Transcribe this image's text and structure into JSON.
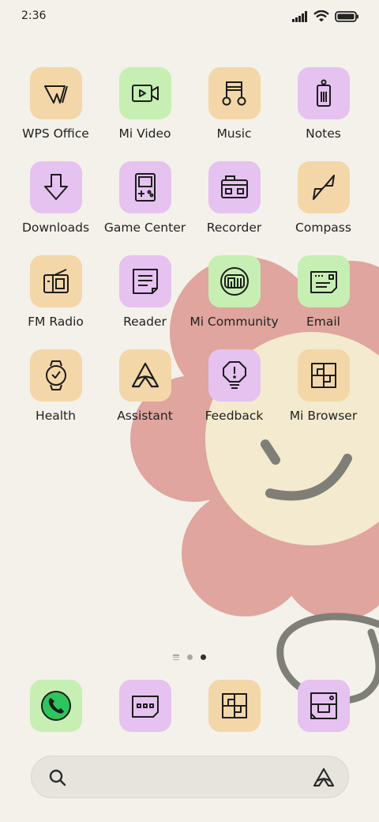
{
  "status_bar": {
    "time": "2:36",
    "icons": [
      "signal-icon",
      "wifi-icon",
      "battery-icon"
    ]
  },
  "apps": [
    {
      "label": "WPS Office",
      "color": "orange",
      "icon": "wps-office-icon"
    },
    {
      "label": "Mi Video",
      "color": "green",
      "icon": "video-camera-icon"
    },
    {
      "label": "Music",
      "color": "orange",
      "icon": "music-note-icon"
    },
    {
      "label": "Notes",
      "color": "purple",
      "icon": "notes-tag-icon"
    },
    {
      "label": "Downloads",
      "color": "purple",
      "icon": "download-arrow-icon"
    },
    {
      "label": "Game Center",
      "color": "purple",
      "icon": "gameboy-icon"
    },
    {
      "label": "Recorder",
      "color": "purple",
      "icon": "recorder-icon"
    },
    {
      "label": "Compass",
      "color": "orange",
      "icon": "compass-needle-icon"
    },
    {
      "label": "FM Radio",
      "color": "orange",
      "icon": "radio-icon"
    },
    {
      "label": "Reader",
      "color": "purple",
      "icon": "document-icon"
    },
    {
      "label": "Mi Community",
      "color": "green",
      "icon": "mi-logo-icon"
    },
    {
      "label": "Email",
      "color": "green",
      "icon": "envelope-icon"
    },
    {
      "label": "Health",
      "color": "orange",
      "icon": "watch-icon"
    },
    {
      "label": "Assistant",
      "color": "orange",
      "icon": "assistant-icon"
    },
    {
      "label": "Feedback",
      "color": "purple",
      "icon": "feedback-bulb-icon"
    },
    {
      "label": "Mi Browser",
      "color": "orange",
      "icon": "browser-grid-icon"
    }
  ],
  "page_indicator": {
    "pages": 3,
    "active": 2
  },
  "dock": [
    {
      "color": "green",
      "icon": "phone-icon"
    },
    {
      "color": "purple",
      "icon": "messages-icon"
    },
    {
      "color": "orange",
      "icon": "browser-grid-icon"
    },
    {
      "color": "purple",
      "icon": "camera-icon"
    }
  ],
  "search": {
    "icons": [
      "search-icon",
      "assistant-icon"
    ]
  },
  "colors": {
    "background": "#f3f1ea",
    "tile_orange": "#f3d7a8",
    "tile_green": "#c7efb3",
    "tile_purple": "#e5c2f0",
    "flower_petal": "#dfa59e",
    "flower_face": "#f3eacf",
    "stem": "#7f7f78"
  }
}
